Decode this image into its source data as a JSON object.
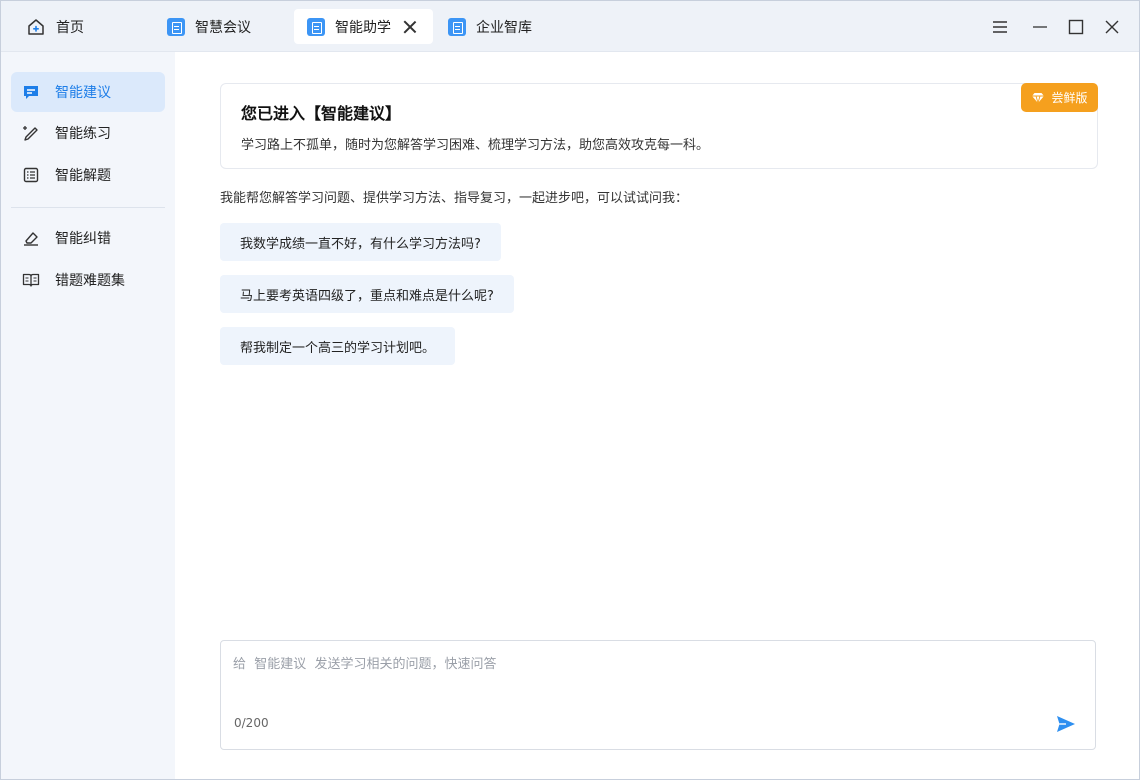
{
  "tabs": [
    {
      "label": "首页"
    },
    {
      "label": "智慧会议"
    },
    {
      "label": "智能助学"
    },
    {
      "label": "企业智库"
    }
  ],
  "sidebar": {
    "items": [
      {
        "label": "智能建议",
        "icon": "chat-bubble-icon"
      },
      {
        "label": "智能练习",
        "icon": "magic-pen-icon"
      },
      {
        "label": "智能解题",
        "icon": "list-doc-icon"
      },
      {
        "label": "智能纠错",
        "icon": "eraser-icon"
      },
      {
        "label": "错题难题集",
        "icon": "open-book-icon"
      }
    ]
  },
  "intro": {
    "title": "您已进入【智能建议】",
    "desc": "学习路上不孤单，随时为您解答学习困难、梳理学习方法，助您高效攻克每一科。",
    "badge": "尝鲜版"
  },
  "help_text": "我能帮您解答学习问题、提供学习方法、指导复习，一起进步吧，可以试试问我：",
  "suggestions": [
    "我数学成绩一直不好，有什么学习方法吗?",
    "马上要考英语四级了，重点和难点是什么呢?",
    "帮我制定一个高三的学习计划吧。"
  ],
  "composer": {
    "placeholder": "给  智能建议  发送学习相关的问题，快速问答",
    "counter": "0/200"
  },
  "colors": {
    "accent": "#1e7ee8",
    "badge": "#f5a01e",
    "sidebar_bg": "#f3f6fb",
    "suggest_bg": "#eef4fc"
  }
}
